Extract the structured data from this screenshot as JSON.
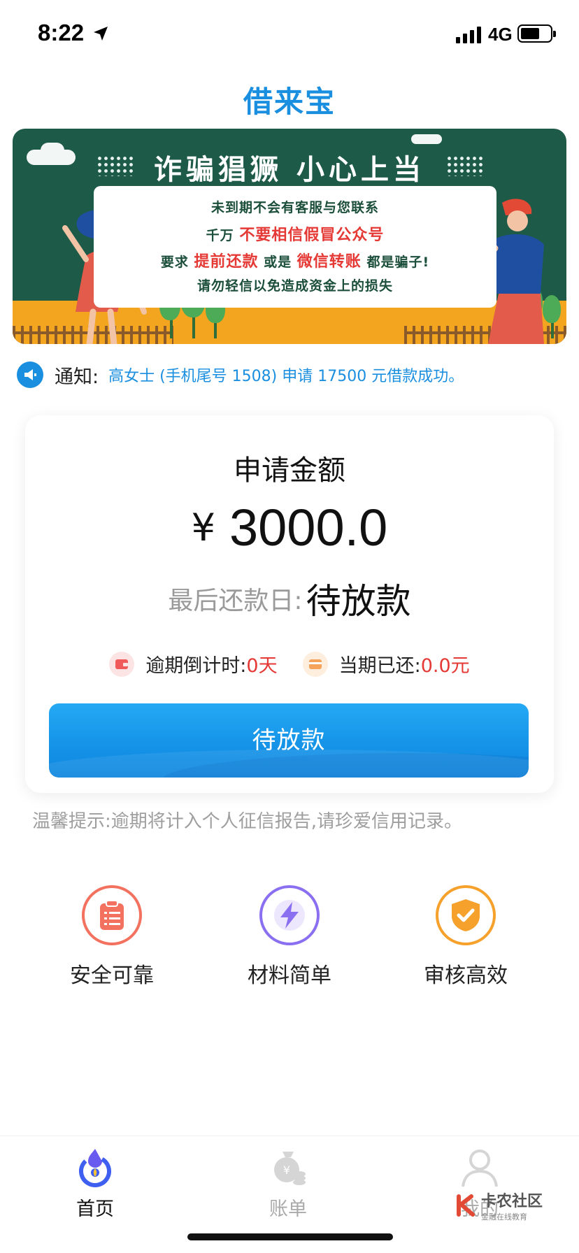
{
  "status_bar": {
    "time": "8:22",
    "network": "4G"
  },
  "app": {
    "title": "借来宝"
  },
  "banner": {
    "headline": "诈骗猖獗 小心上当",
    "line1": "未到期不会有客服与您联系",
    "line2_pre": "千万",
    "line2_red": "不要相信假冒公众号",
    "line3_pre": "要求",
    "line3_red1": "提前还款",
    "line3_mid": "或是",
    "line3_red2": "微信转账",
    "line3_post": "都是骗子!",
    "line4": "请勿轻信以免造成资金上的损失"
  },
  "notice": {
    "label": "通知:",
    "text": "高女士 (手机尾号 1508) 申请 17500 元借款成功。"
  },
  "loan_card": {
    "title": "申请金额",
    "currency": "¥",
    "amount": "3000.0",
    "due_label": "最后还款日:",
    "due_value": "待放款",
    "countdown_label": "逾期倒计时:",
    "countdown_value": "0天",
    "repaid_label": "当期已还:",
    "repaid_value": "0.0元",
    "button_label": "待放款"
  },
  "tip": "温馨提示:逾期将计入个人征信报告,请珍爱信用记录。",
  "features": [
    {
      "label": "安全可靠",
      "icon": "clipboard-icon",
      "color": "#f2715f"
    },
    {
      "label": "材料简单",
      "icon": "lightning-icon",
      "color": "#8a6ff0"
    },
    {
      "label": "审核高效",
      "icon": "shield-check-icon",
      "color": "#f5a12b"
    }
  ],
  "tabs": [
    {
      "label": "首页",
      "icon": "home-icon",
      "active": true
    },
    {
      "label": "账单",
      "icon": "bill-icon",
      "active": false
    },
    {
      "label": "我的",
      "icon": "profile-icon",
      "active": false
    }
  ],
  "watermark": {
    "text": "卡农社区",
    "subtext": "金融在线教育"
  },
  "colors": {
    "accent": "#1a8fe0",
    "alert": "#e53935",
    "banner_green": "#1e5a48"
  }
}
